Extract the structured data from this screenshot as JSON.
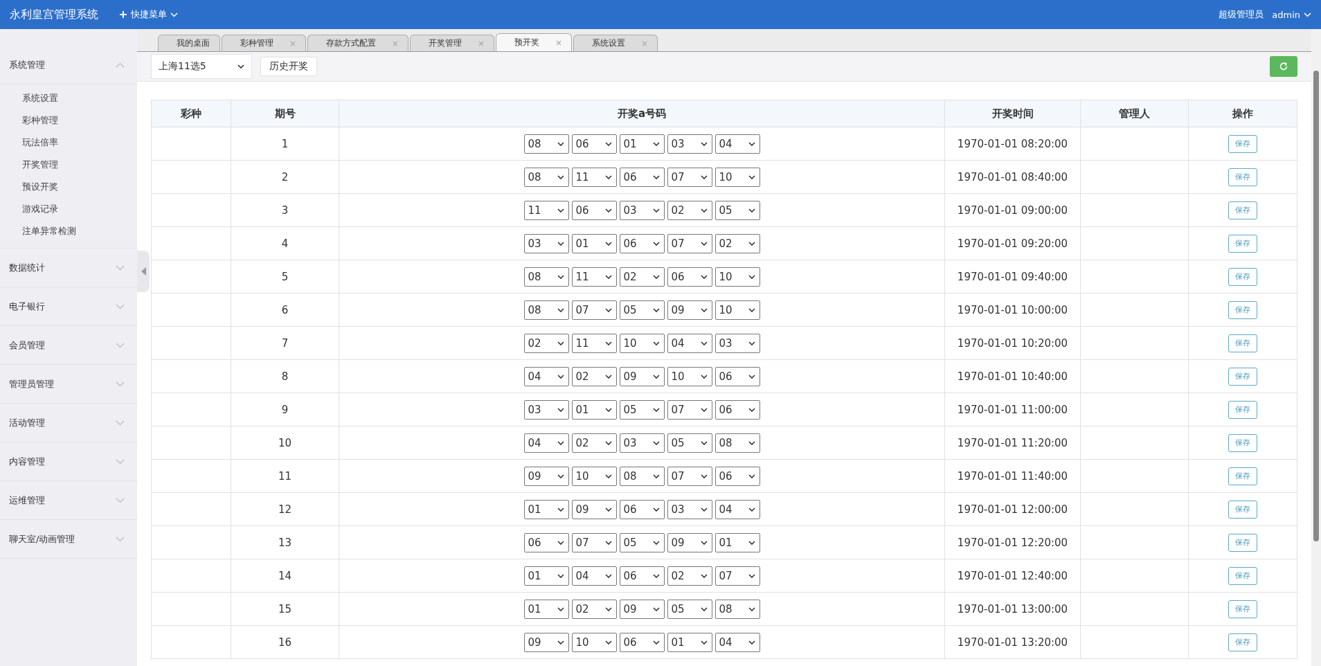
{
  "header": {
    "title": "永利皇宫管理系统",
    "quick_menu": "快捷菜单",
    "role": "超级管理员",
    "user": "admin"
  },
  "sidebar": {
    "groups": [
      {
        "label": "系统管理",
        "expanded": true,
        "children": [
          {
            "label": "系统设置"
          },
          {
            "label": "彩种管理"
          },
          {
            "label": "玩法倍率"
          },
          {
            "label": "开奖管理"
          },
          {
            "label": "预设开奖"
          },
          {
            "label": "游戏记录"
          },
          {
            "label": "注单异常检测"
          }
        ]
      },
      {
        "label": "数据统计",
        "expanded": false
      },
      {
        "label": "电子银行",
        "expanded": false
      },
      {
        "label": "会员管理",
        "expanded": false
      },
      {
        "label": "管理员管理",
        "expanded": false
      },
      {
        "label": "活动管理",
        "expanded": false
      },
      {
        "label": "内容管理",
        "expanded": false
      },
      {
        "label": "运维管理",
        "expanded": false
      },
      {
        "label": "聊天室/动画管理",
        "expanded": false
      }
    ]
  },
  "tabs": [
    {
      "label": "我的桌面",
      "selected": false,
      "closable": false
    },
    {
      "label": "彩种管理",
      "selected": false,
      "closable": true
    },
    {
      "label": "存款方式配置",
      "selected": false,
      "closable": true
    },
    {
      "label": "开奖管理",
      "selected": false,
      "closable": true
    },
    {
      "label": "预开奖",
      "selected": true,
      "closable": true
    },
    {
      "label": "系统设置",
      "selected": false,
      "closable": true
    }
  ],
  "toolbar": {
    "lottery_select": "上海11选5",
    "history_button": "历史开奖"
  },
  "table": {
    "columns": [
      "彩种",
      "期号",
      "开奖a号码",
      "开奖时间",
      "管理人",
      "操作"
    ],
    "rows": [
      {
        "issue": "1",
        "numbers": [
          "08",
          "06",
          "01",
          "03",
          "04"
        ],
        "time": "1970-01-01 08:20:00",
        "action": "保存"
      },
      {
        "issue": "2",
        "numbers": [
          "08",
          "11",
          "06",
          "07",
          "10"
        ],
        "time": "1970-01-01 08:40:00",
        "action": "保存"
      },
      {
        "issue": "3",
        "numbers": [
          "11",
          "06",
          "03",
          "02",
          "05"
        ],
        "time": "1970-01-01 09:00:00",
        "action": "保存"
      },
      {
        "issue": "4",
        "numbers": [
          "03",
          "01",
          "06",
          "07",
          "02"
        ],
        "time": "1970-01-01 09:20:00",
        "action": "保存"
      },
      {
        "issue": "5",
        "numbers": [
          "08",
          "11",
          "02",
          "06",
          "10"
        ],
        "time": "1970-01-01 09:40:00",
        "action": "保存"
      },
      {
        "issue": "6",
        "numbers": [
          "08",
          "07",
          "05",
          "09",
          "10"
        ],
        "time": "1970-01-01 10:00:00",
        "action": "保存"
      },
      {
        "issue": "7",
        "numbers": [
          "02",
          "11",
          "10",
          "04",
          "03"
        ],
        "time": "1970-01-01 10:20:00",
        "action": "保存"
      },
      {
        "issue": "8",
        "numbers": [
          "04",
          "02",
          "09",
          "10",
          "06"
        ],
        "time": "1970-01-01 10:40:00",
        "action": "保存"
      },
      {
        "issue": "9",
        "numbers": [
          "03",
          "01",
          "05",
          "07",
          "06"
        ],
        "time": "1970-01-01 11:00:00",
        "action": "保存"
      },
      {
        "issue": "10",
        "numbers": [
          "04",
          "02",
          "03",
          "05",
          "08"
        ],
        "time": "1970-01-01 11:20:00",
        "action": "保存"
      },
      {
        "issue": "11",
        "numbers": [
          "09",
          "10",
          "08",
          "07",
          "06"
        ],
        "time": "1970-01-01 11:40:00",
        "action": "保存"
      },
      {
        "issue": "12",
        "numbers": [
          "01",
          "09",
          "06",
          "03",
          "04"
        ],
        "time": "1970-01-01 12:00:00",
        "action": "保存"
      },
      {
        "issue": "13",
        "numbers": [
          "06",
          "07",
          "05",
          "09",
          "01"
        ],
        "time": "1970-01-01 12:20:00",
        "action": "保存"
      },
      {
        "issue": "14",
        "numbers": [
          "01",
          "04",
          "06",
          "02",
          "07"
        ],
        "time": "1970-01-01 12:40:00",
        "action": "保存"
      },
      {
        "issue": "15",
        "numbers": [
          "01",
          "02",
          "09",
          "05",
          "08"
        ],
        "time": "1970-01-01 13:00:00",
        "action": "保存"
      },
      {
        "issue": "16",
        "numbers": [
          "09",
          "10",
          "06",
          "01",
          "04"
        ],
        "time": "1970-01-01 13:20:00",
        "action": "保存"
      }
    ]
  }
}
